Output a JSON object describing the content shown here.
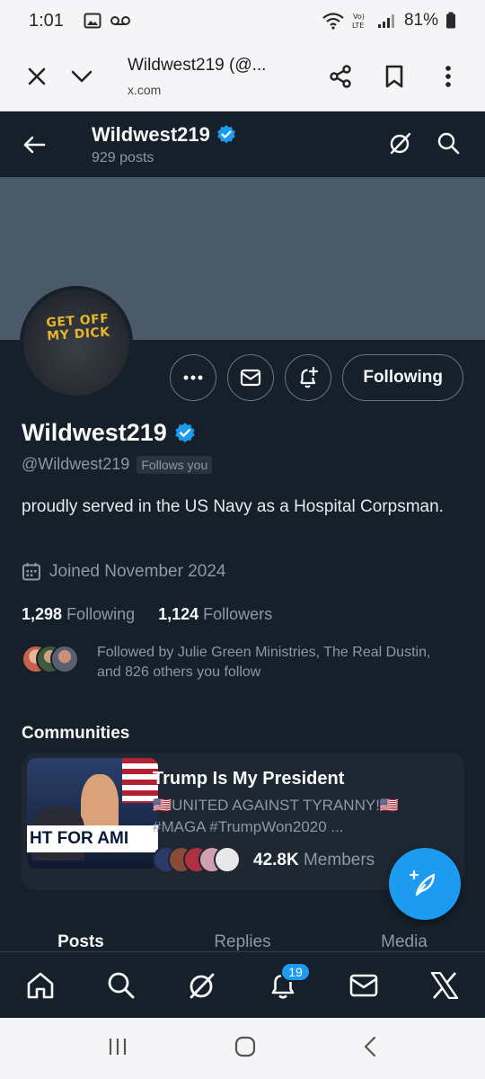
{
  "status_bar": {
    "time": "1:01",
    "battery": "81%",
    "signal_label": "Vo)\nLTE"
  },
  "browser": {
    "title": "Wildwest219 (@...",
    "url": "x.com"
  },
  "header": {
    "name": "Wildwest219",
    "posts": "929 posts"
  },
  "profile": {
    "avatar_text": "GET OFF MY DICK",
    "name": "Wildwest219",
    "handle": "@Wildwest219",
    "follows_you": "Follows you",
    "following_button": "Following",
    "bio": "proudly served in the US Navy as a Hospital Corpsman.",
    "joined": "Joined November 2024",
    "following_count": "1,298",
    "following_label": "Following",
    "followers_count": "1,124",
    "followers_label": "Followers",
    "followed_by": "Followed by Julie Green Ministries, The Real Dustin, and 826 others you follow"
  },
  "communities": {
    "title": "Communities",
    "card": {
      "image_text": "HT FOR AMI",
      "name": "Trump Is My President",
      "desc_line1": "🇺🇸UNITED AGAINST TYRANNY!🇺🇸",
      "desc_line2": "#MAGA #TrumpWon2020 ...",
      "members_count": "42.8K",
      "members_label": "Members"
    }
  },
  "tabs": [
    {
      "label": "Posts"
    },
    {
      "label": "Replies"
    },
    {
      "label": "Media"
    }
  ],
  "bottom_nav": {
    "notification_count": "19"
  },
  "colors": {
    "background": "#15202b",
    "accent": "#1d9bf0",
    "verified": "#1d9bf0",
    "banner": "#4a5a68"
  }
}
